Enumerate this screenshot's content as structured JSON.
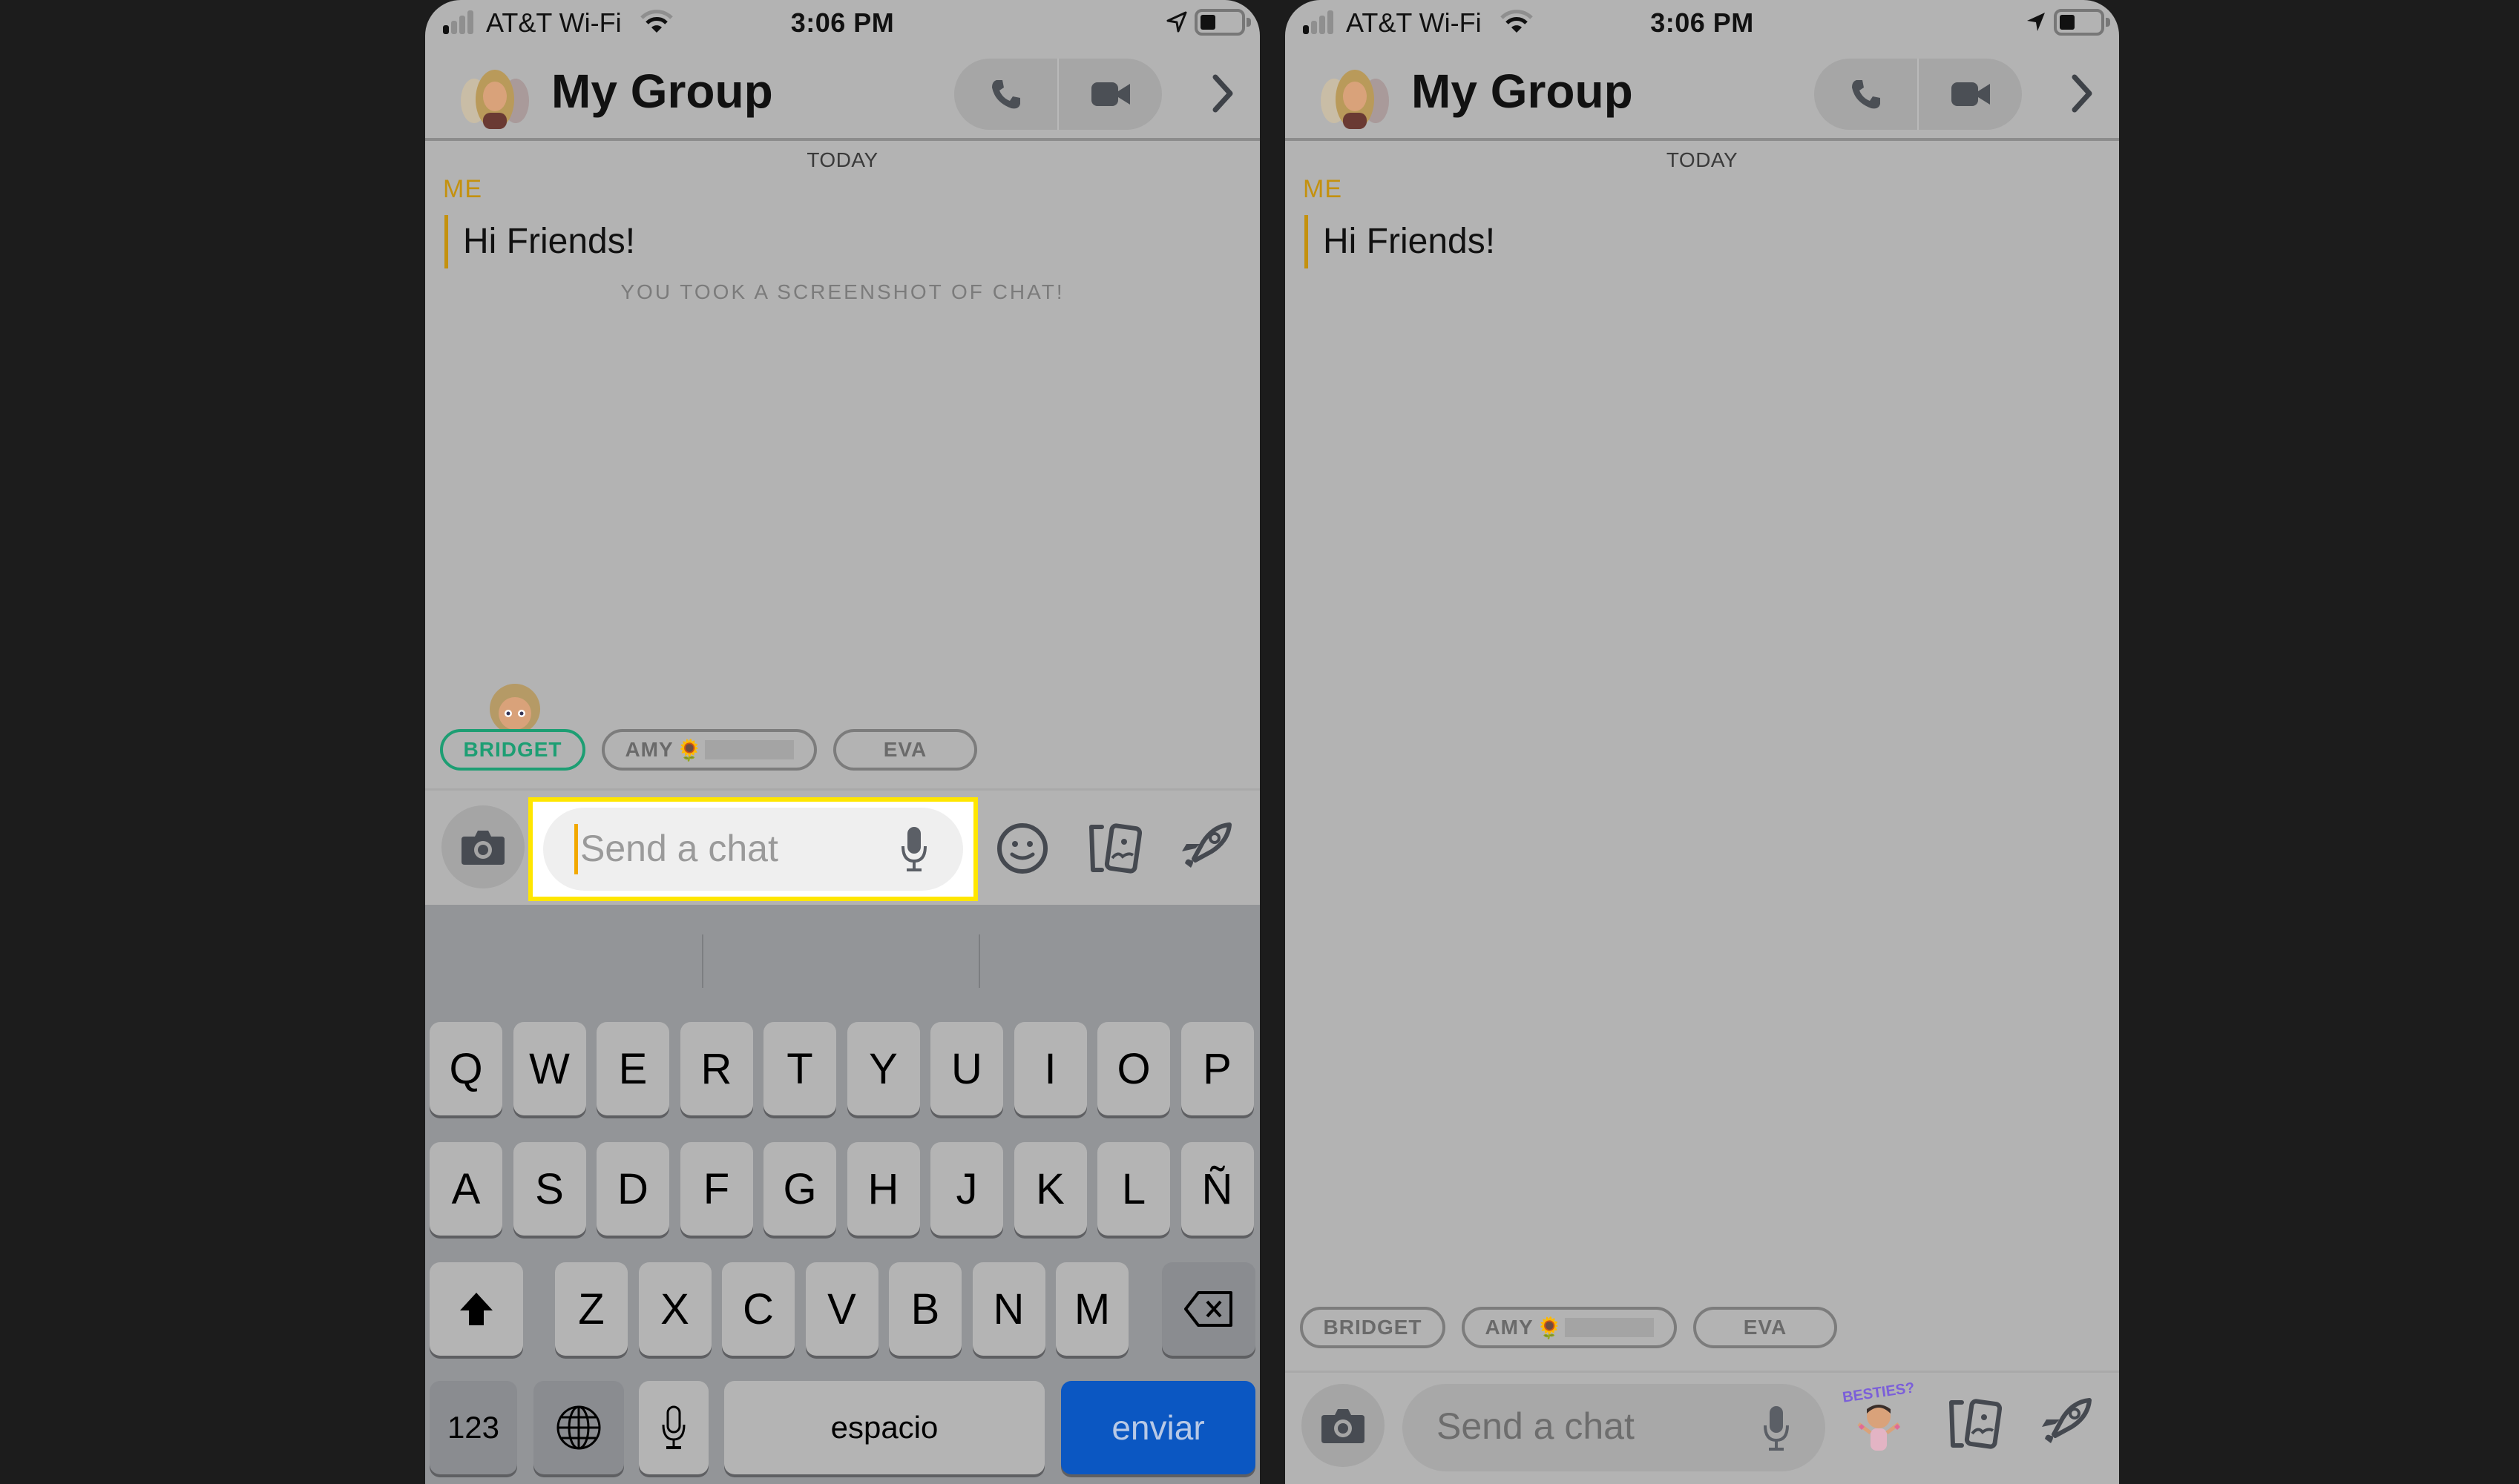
{
  "status_bar": {
    "carrier": "AT&T Wi-Fi",
    "time": "3:06 PM"
  },
  "header": {
    "title": "My Group",
    "call_label": "voice-call",
    "video_label": "video-call"
  },
  "messages": {
    "day": "TODAY",
    "sender": "ME",
    "text": "Hi Friends!",
    "notice": "YOU TOOK A SCREENSHOT OF CHAT!"
  },
  "members": [
    {
      "name": "BRIDGET",
      "emoji": ""
    },
    {
      "name": "AMY",
      "emoji": "🌻"
    },
    {
      "name": "EVA",
      "emoji": ""
    }
  ],
  "composer": {
    "placeholder": "Send a chat",
    "sticker_text": "BESTIES?"
  },
  "keyboard": {
    "row1": [
      "Q",
      "W",
      "E",
      "R",
      "T",
      "Y",
      "U",
      "I",
      "O",
      "P"
    ],
    "row2": [
      "A",
      "S",
      "D",
      "F",
      "G",
      "H",
      "J",
      "K",
      "L",
      "Ñ"
    ],
    "row3": [
      "Z",
      "X",
      "C",
      "V",
      "B",
      "N",
      "M"
    ],
    "numbers": "123",
    "space": "espacio",
    "send": "enviar"
  },
  "colors": {
    "highlight": "#ffe600",
    "active_member": "#1d9e73",
    "sender": "#c4910e",
    "send_key": "#0b57c2"
  }
}
